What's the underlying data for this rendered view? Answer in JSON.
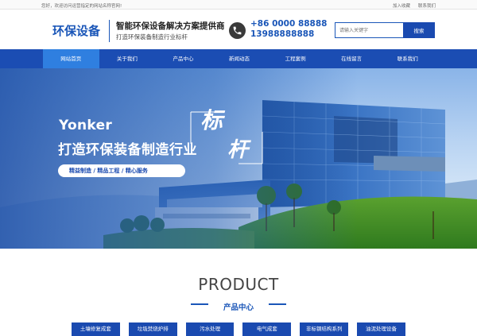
{
  "topbar": {
    "welcome": "您好，欢迎访问运营指定的网站名称官网!",
    "links": [
      "加入收藏",
      "联系我们"
    ]
  },
  "header": {
    "logo": "环保设备",
    "slogan_main": "智能环保设备解决方案提供商",
    "slogan_sub": "打造环保装备制造行业标杆",
    "phone_1": "+86 0000 88888",
    "phone_2": "13988888888",
    "phone_icon": "phone-icon"
  },
  "search": {
    "placeholder": "请输入关键字",
    "button": "搜索"
  },
  "nav": {
    "items": [
      {
        "label": "网站首页",
        "active": true
      },
      {
        "label": "关于我们",
        "active": false
      },
      {
        "label": "产品中心",
        "active": false
      },
      {
        "label": "新闻动态",
        "active": false
      },
      {
        "label": "工程案例",
        "active": false
      },
      {
        "label": "在线留言",
        "active": false
      },
      {
        "label": "联系我们",
        "active": false
      }
    ]
  },
  "banner": {
    "brand": "Yonker",
    "headline": "打造环保装备制造行业",
    "calligraphy_1": "标",
    "calligraphy_2": "杆",
    "tags": "精益制造 / 精品工程 / 精心服务"
  },
  "product": {
    "title": "PRODUCT",
    "subtitle": "产品中心",
    "categories": [
      "土壤修复成套",
      "垃圾焚烧炉排",
      "污水处理",
      "电气成套",
      "非标钢结构系列",
      "油泥处理设备"
    ]
  },
  "colors": {
    "brand_blue": "#1a56b8",
    "nav_blue": "#1b4db3",
    "nav_active": "#2f7fe0"
  }
}
